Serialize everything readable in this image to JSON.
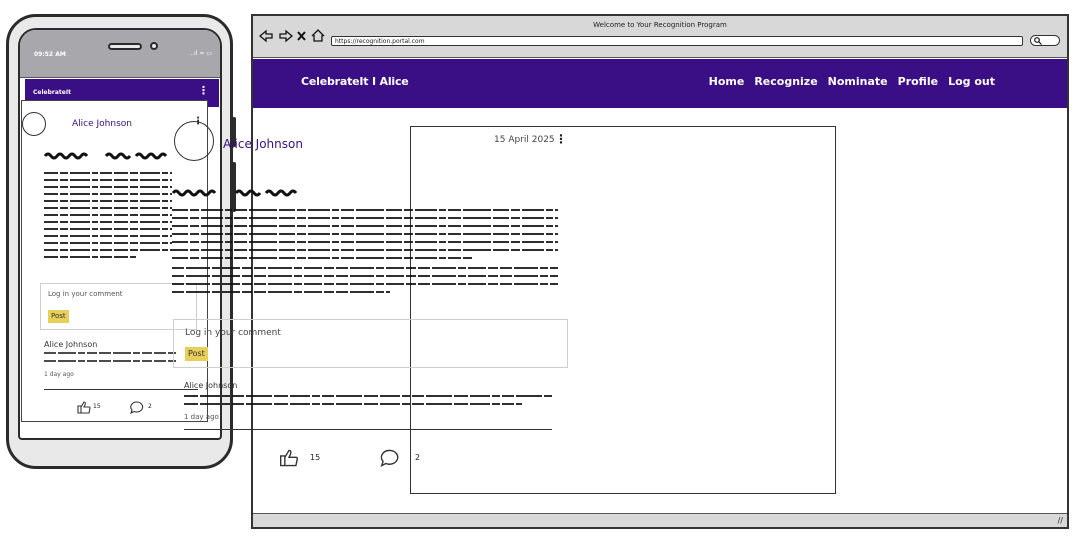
{
  "window": {
    "title": "Welcome to Your Recognition Program",
    "url": "https://recognition.portal.com"
  },
  "app": {
    "brand_desktop": "CelebrateIt  I  Alice",
    "brand_mobile": "CelebrateIt",
    "nav": [
      "Home",
      "Recognize",
      "Nominate",
      "Profile",
      "Log out"
    ]
  },
  "phone": {
    "time": "09:52 AM",
    "status_icons": "..ıl ≈ ▭"
  },
  "post": {
    "author": "Alice Johnson",
    "date": "15 April 2025",
    "comment_placeholder": "Log in your comment",
    "post_button": "Post",
    "likes": "15",
    "comments_count": "2"
  },
  "comment": {
    "author": "Alice Johnson",
    "time": "1 day ago"
  },
  "colors": {
    "brand": "#3a0f86",
    "accent": "#e7cf5a"
  }
}
